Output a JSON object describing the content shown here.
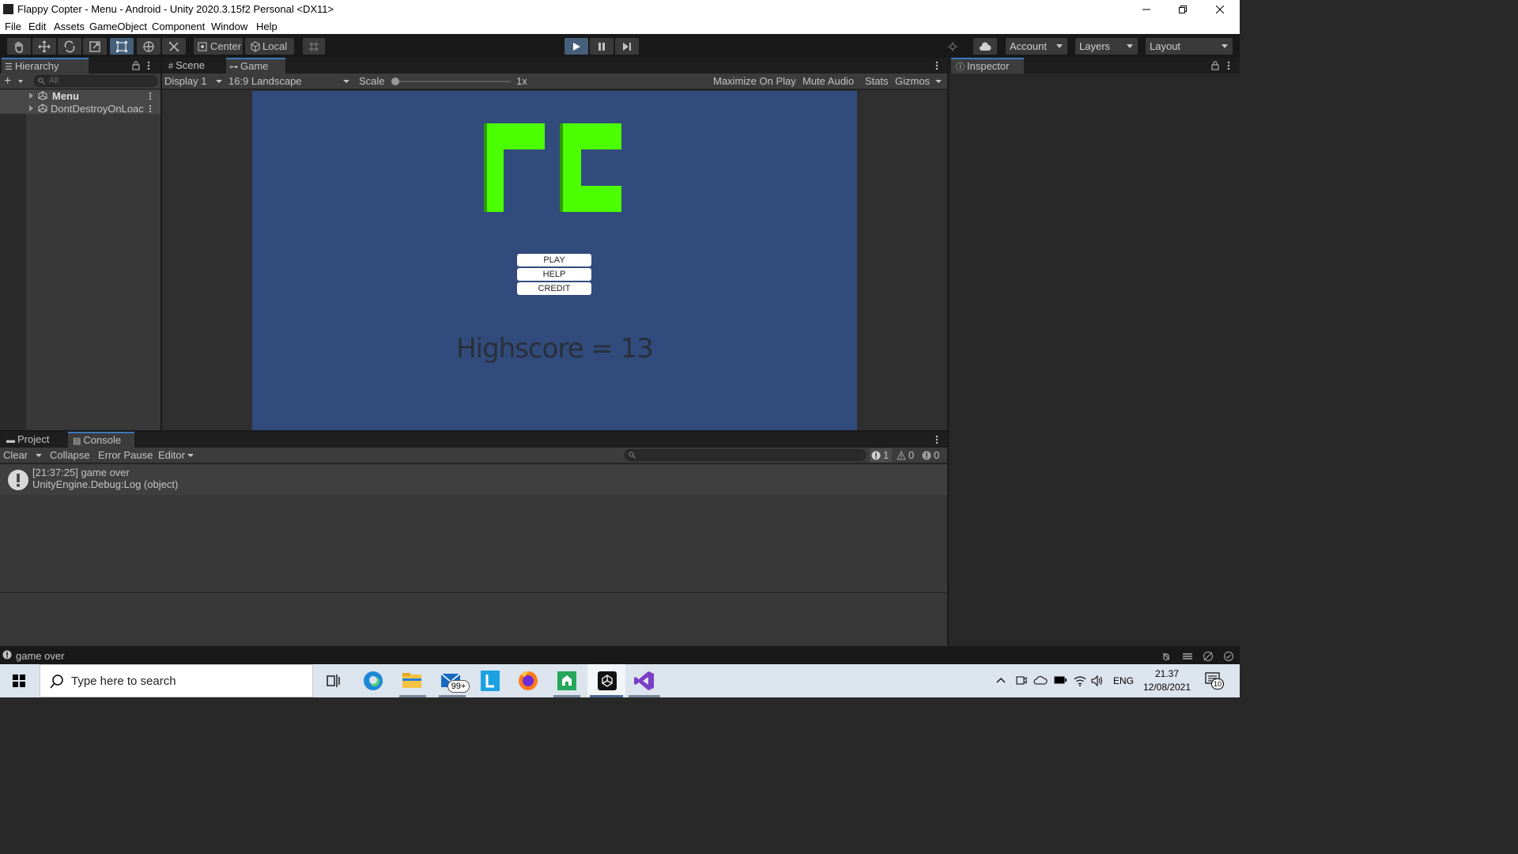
{
  "window": {
    "title": "Flappy Copter - Menu - Android - Unity 2020.3.15f2 Personal <DX11>"
  },
  "menu": [
    "File",
    "Edit",
    "Assets",
    "GameObject",
    "Component",
    "Window",
    "Help"
  ],
  "toolbar": {
    "pivot_label": "Center",
    "space_label": "Local",
    "account_label": "Account",
    "layers_label": "Layers",
    "layout_label": "Layout"
  },
  "hierarchy": {
    "tab_label": "Hierarchy",
    "search_placeholder": "All",
    "items": [
      "Menu",
      "DontDestroyOnLoac"
    ]
  },
  "scene_tabs": [
    "Scene",
    "Game"
  ],
  "game_bar": {
    "display": "Display 1",
    "aspect": "16:9 Landscape",
    "scale_label": "Scale",
    "scale_value": "1x",
    "scale_fraction": 0.0,
    "maximize": "Maximize On Play",
    "mute": "Mute Audio",
    "stats": "Stats",
    "gizmos": "Gizmos"
  },
  "game": {
    "buttons": [
      "PLAY",
      "HELP",
      "CREDIT"
    ],
    "highscore": "Highscore = 13",
    "colors": {
      "background": "#314c7c",
      "logo": "#4cff00",
      "logo_shadow": "#2e9a00",
      "score_text": "#2a2f3a"
    }
  },
  "inspector": {
    "tab_label": "Inspector"
  },
  "bottom_tabs": [
    "Project",
    "Console"
  ],
  "console": {
    "toolbar": {
      "clear": "Clear",
      "collapse": "Collapse",
      "error_pause": "Error Pause",
      "editor": "Editor"
    },
    "counts": {
      "log": "1",
      "warn": "0",
      "error": "0"
    },
    "entries": [
      {
        "line1": "[21:37:25] game over",
        "line2": "UnityEngine.Debug:Log (object)"
      }
    ]
  },
  "status_bar": {
    "message": "game over"
  },
  "taskbar": {
    "search_placeholder": "Type here to search",
    "mail_badge": "99+",
    "language": "ENG",
    "time": "21.37",
    "date": "12/08/2021",
    "notification_count": "10"
  },
  "accent_colors": {
    "play_active": "#46607c",
    "tab_highlight": "#3a79bb"
  }
}
